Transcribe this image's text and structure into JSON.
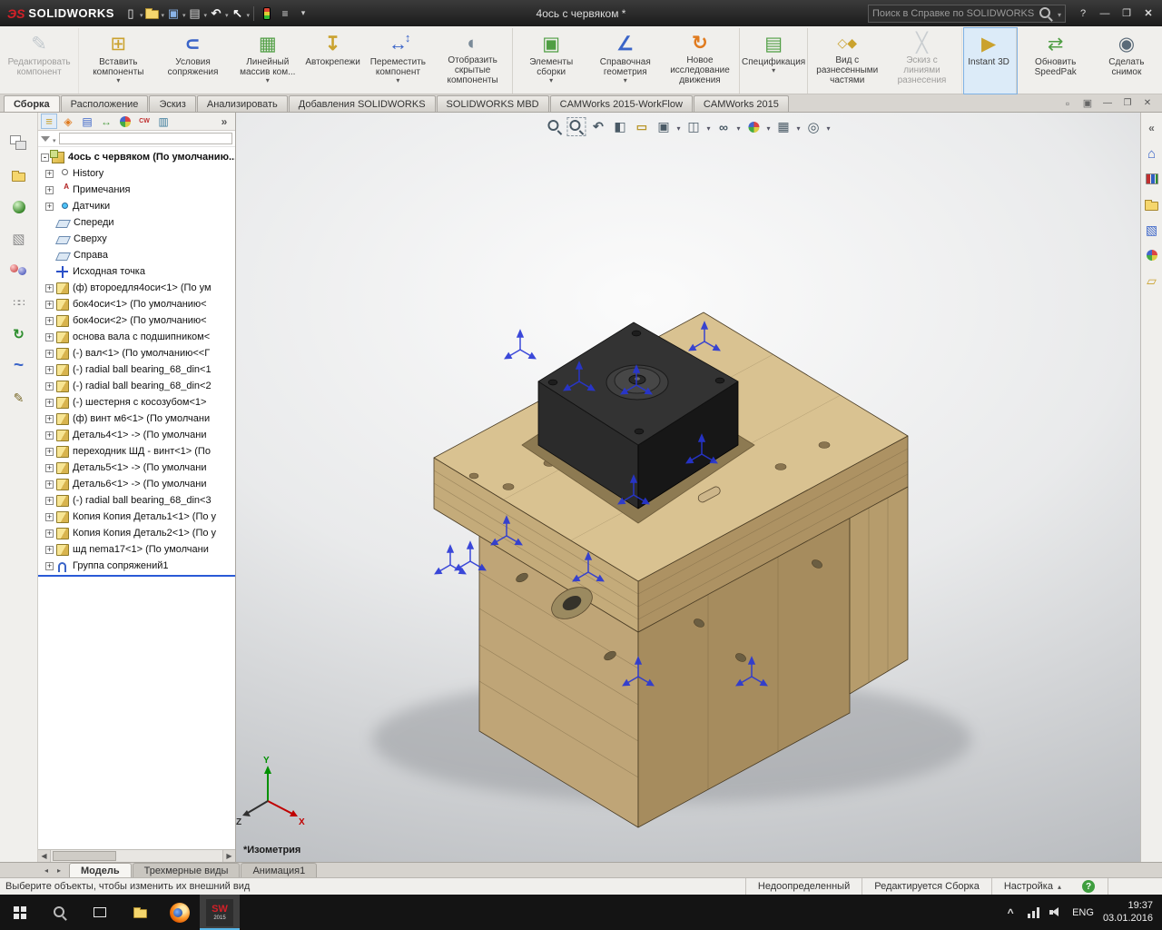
{
  "title_bar": {
    "logo_mark": "ЭS",
    "logo_text": "SOLIDWORKS",
    "document_title": "4ось с червяком *",
    "search_placeholder": "Поиск в Справке по SOLIDWORKS",
    "quick_icons": [
      "new-document",
      "open",
      "save",
      "print",
      "undo",
      "select",
      "rebuild",
      "file-properties",
      "toolbar-options"
    ],
    "window": {
      "help": "?",
      "minimize": "—",
      "maximize": "❐",
      "close": "✕"
    }
  },
  "ribbon": {
    "buttons": [
      {
        "label": "Редактировать компонент",
        "icon": "edit-component",
        "state": "disabled",
        "sep": "sep"
      },
      {
        "label": "Вставить компоненты",
        "icon": "insert-components",
        "arrow": "▾"
      },
      {
        "label": "Условия сопряжения",
        "icon": "mate"
      },
      {
        "label": "Линейный массив ком...",
        "icon": "linear-pattern",
        "arrow": "▾"
      },
      {
        "label": "Автокрепежи",
        "icon": "smart-fasteners"
      },
      {
        "label": "Переместить компонент",
        "icon": "move-component",
        "arrow": "▾"
      },
      {
        "label": "Отобразить скрытые компоненты",
        "icon": "show-hidden",
        "sep": "sep"
      },
      {
        "label": "Элементы сборки",
        "icon": "assembly-features",
        "arrow": "▾"
      },
      {
        "label": "Справочная геометрия",
        "icon": "reference-geometry",
        "arrow": "▾"
      },
      {
        "label": "Новое исследование движения",
        "icon": "motion-study",
        "sep": "sep"
      },
      {
        "label": "Спецификация",
        "icon": "bom",
        "arrow": "▾",
        "sep": "sep"
      },
      {
        "label": "Вид с разнесенными частями",
        "icon": "exploded-view"
      },
      {
        "label": "Эскиз с линиями разнесения",
        "icon": "explode-lines",
        "state": "disabled",
        "sep": "sep"
      },
      {
        "label": "Instant 3D",
        "icon": "instant-3d",
        "state": "active",
        "sep": "sep"
      },
      {
        "label": "Обновить SpeedPak",
        "icon": "update-speedpak"
      },
      {
        "label": "Сделать снимок",
        "icon": "snapshot"
      }
    ]
  },
  "command_tabs": [
    {
      "label": "Сборка",
      "state": "active"
    },
    {
      "label": "Расположение"
    },
    {
      "label": "Эскиз"
    },
    {
      "label": "Анализировать"
    },
    {
      "label": "Добавления SOLIDWORKS"
    },
    {
      "label": "SOLIDWORKS MBD"
    },
    {
      "label": "CAMWorks 2015-WorkFlow"
    },
    {
      "label": "CAMWorks 2015"
    }
  ],
  "mdi": {
    "minimize": "—",
    "restore": "❐",
    "close": "✕"
  },
  "left_toolbar": {
    "icons": [
      "panes",
      "folder",
      "sphere",
      "cube",
      "appearance-balls",
      "hole-grid",
      "refresh",
      "spline",
      "pencil"
    ]
  },
  "tree_panel": {
    "tabs": [
      "feature-manager",
      "property-manager",
      "configuration-manager",
      "dimxpert-manager",
      "display-manager",
      "camworks-features",
      "camworks-operations"
    ],
    "overflow": "»",
    "filter": {
      "value": ""
    },
    "root": {
      "expander": "-",
      "icon": "assembly",
      "label": "4ось с червяком (По умолчанию..."
    },
    "items": [
      {
        "expander": "+",
        "icon": "history",
        "label": "History"
      },
      {
        "expander": "+",
        "icon": "annotations",
        "label": "Примечания"
      },
      {
        "expander": "+",
        "icon": "sensors",
        "label": "Датчики"
      },
      {
        "icon": "plane",
        "label": "Спереди"
      },
      {
        "icon": "plane",
        "label": "Сверху"
      },
      {
        "icon": "plane",
        "label": "Справа"
      },
      {
        "icon": "origin",
        "label": "Исходная точка"
      },
      {
        "expander": "+",
        "icon": "part",
        "label": "(ф) второедля4оси<1> (По ум"
      },
      {
        "expander": "+",
        "icon": "part",
        "label": "бок4оси<1> (По умолчанию<"
      },
      {
        "expander": "+",
        "icon": "part",
        "label": "бок4оси<2> (По умолчанию<"
      },
      {
        "expander": "+",
        "icon": "part",
        "label": "основа вала с подшипником<"
      },
      {
        "expander": "+",
        "icon": "part",
        "label": "(-) вал<1> (По умолчанию<<Г"
      },
      {
        "expander": "+",
        "icon": "part",
        "label": "(-) radial ball bearing_68_din<1"
      },
      {
        "expander": "+",
        "icon": "part",
        "label": "(-) radial ball bearing_68_din<2"
      },
      {
        "expander": "+",
        "icon": "part",
        "label": "(-) шестерня с косозубом<1>"
      },
      {
        "expander": "+",
        "icon": "part",
        "label": "(ф) винт м6<1> (По умолчани"
      },
      {
        "expander": "+",
        "icon": "part",
        "label": "Деталь4<1> -> (По умолчани"
      },
      {
        "expander": "+",
        "icon": "part",
        "label": "переходник ШД - винт<1> (По"
      },
      {
        "expander": "+",
        "icon": "part",
        "label": "Деталь5<1> -> (По умолчани"
      },
      {
        "expander": "+",
        "icon": "part",
        "label": "Деталь6<1> -> (По умолчани"
      },
      {
        "expander": "+",
        "icon": "part",
        "label": "(-) radial ball bearing_68_din<3"
      },
      {
        "expander": "+",
        "icon": "part",
        "label": "Копия Копия Деталь1<1> (По у"
      },
      {
        "expander": "+",
        "icon": "part",
        "label": "Копия Копия Деталь2<1> (По у"
      },
      {
        "expander": "+",
        "icon": "part",
        "label": "шд nema17<1> (По умолчани"
      },
      {
        "expander": "+",
        "icon": "mates",
        "label": "Группа сопряжений1"
      }
    ]
  },
  "heads_up": {
    "icons": [
      "zoom-fit",
      "zoom-area",
      "previous-view",
      "section-view",
      "measure",
      "view-orientation",
      "display-style",
      "hide-show-items",
      "edit-appearance",
      "apply-scene",
      "view-settings"
    ]
  },
  "viewport": {
    "view_label": "*Изометрия",
    "origin": {
      "x": "X",
      "y": "Y",
      "z": "Z"
    }
  },
  "task_pane": {
    "icons": [
      "collapse",
      "solidworks-resources",
      "design-library",
      "file-explorer",
      "view-palette",
      "appearances-scenes",
      "custom-properties"
    ]
  },
  "bottom_tabs": [
    {
      "label": "Модель",
      "state": "active"
    },
    {
      "label": "Трехмерные виды"
    },
    {
      "label": "Анимация1"
    }
  ],
  "status_bar": {
    "message": "Выберите объекты, чтобы изменить их внешний вид",
    "state": "Недоопределенный",
    "mode": "Редактируется Сборка",
    "customize": "Настройка",
    "help": "?"
  },
  "taskbar": {
    "sw_mark": "SW",
    "sw_year": "2015",
    "language": "ENG",
    "time": "19:37",
    "date": "03.01.2016",
    "app_icons": [
      "start",
      "search",
      "task-view",
      "file-explorer",
      "firefox",
      "solidworks-2015"
    ]
  },
  "colors": {
    "accent_blue": "#2a6ab0",
    "mate_arrow_blue": "#2736d6",
    "wood": "#c9ae7c",
    "motor_black": "#262626",
    "brand_red": "#d42028"
  }
}
